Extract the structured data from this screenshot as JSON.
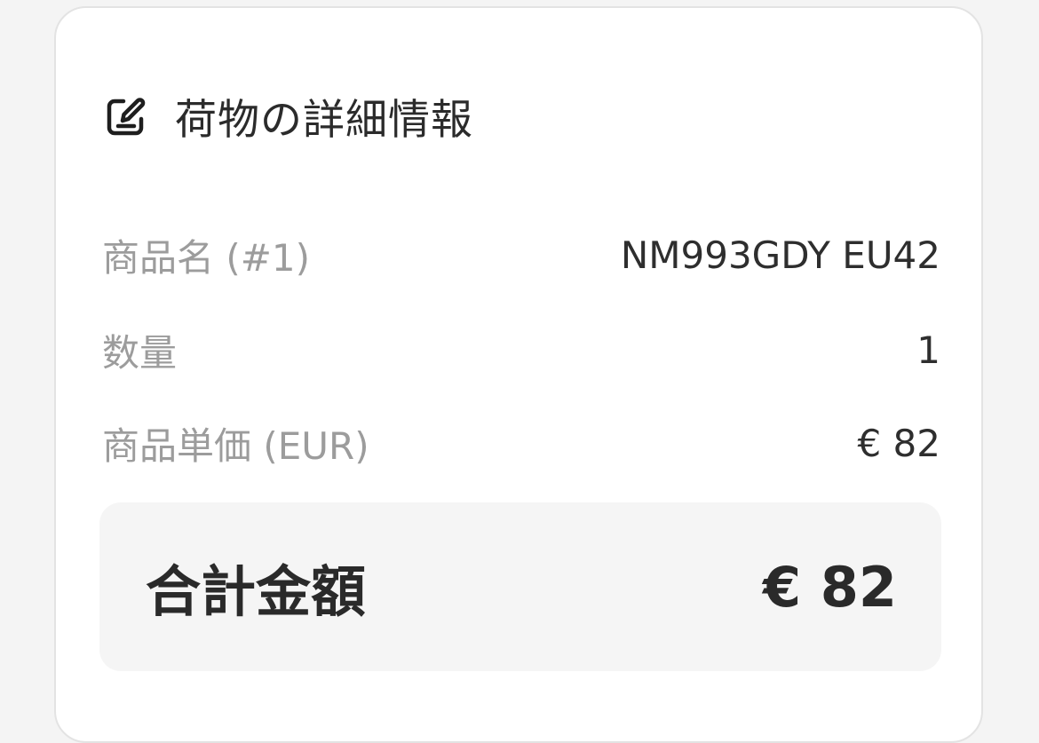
{
  "section": {
    "title": "荷物の詳細情報",
    "icon": "edit-icon"
  },
  "details": [
    {
      "label": "商品名 (#1)",
      "value": "NM993GDY EU42"
    },
    {
      "label": "数量",
      "value": "1"
    },
    {
      "label": "商品単価 (EUR)",
      "value": "€ 82"
    }
  ],
  "total": {
    "label": "合計金額",
    "value": "€ 82"
  },
  "colors": {
    "label_gray": "#9c9c9c",
    "text_dark": "#2e2e2e",
    "total_bg": "#f5f5f5",
    "card_border": "#e3e3e3"
  }
}
